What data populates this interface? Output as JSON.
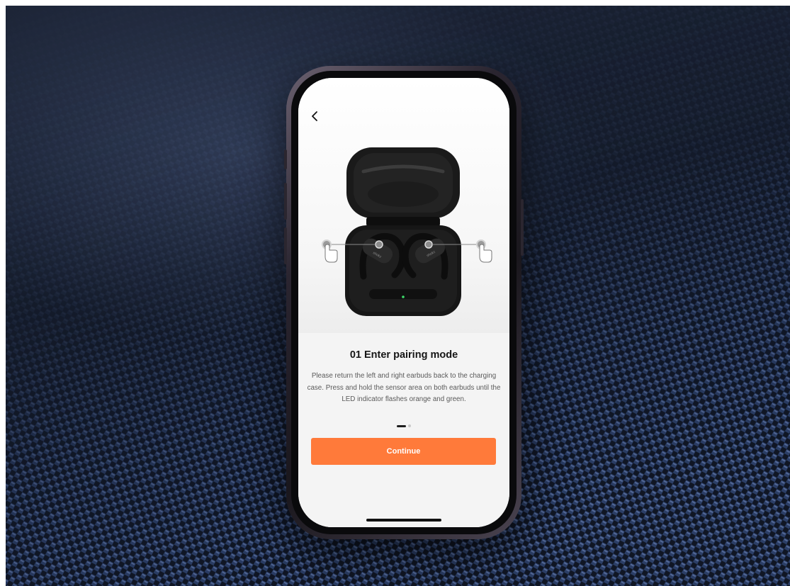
{
  "onboarding": {
    "step_title": "01 Enter pairing mode",
    "step_description": "Please return the left and right earbuds back to the charging case. Press and hold the sensor area on both earbuds until the LED indicator flashes orange and green.",
    "continue_label": "Continue",
    "pager": {
      "total_pages": 2,
      "current_page": 1
    },
    "hero_image": "open-charging-case-with-earbuds",
    "icons": [
      "back-chevron-icon",
      "finger-tap-icon"
    ]
  },
  "colors": {
    "accent": "#ff7a3a",
    "background": "#141b2a",
    "screen": "#f3f3f3",
    "led_indicator": "#3ddc6a"
  }
}
